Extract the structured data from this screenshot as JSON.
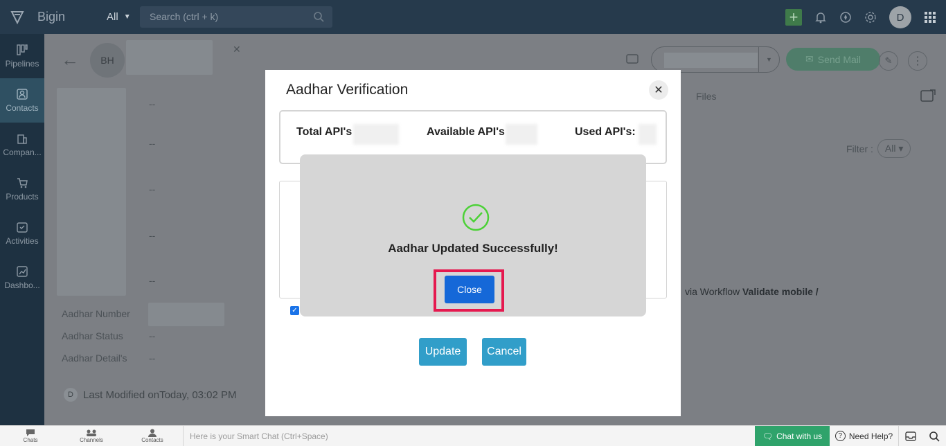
{
  "app": {
    "name": "Bigin"
  },
  "topbar": {
    "scope_label": "All",
    "search_placeholder": "Search (ctrl + k)",
    "user_initial": "D"
  },
  "sidebar": {
    "items": [
      {
        "label": "Pipelines",
        "icon": "pipelines-icon"
      },
      {
        "label": "Contacts",
        "icon": "contacts-icon",
        "active": true
      },
      {
        "label": "Compan...",
        "icon": "companies-icon"
      },
      {
        "label": "Products",
        "icon": "products-icon"
      },
      {
        "label": "Activities",
        "icon": "activities-icon"
      },
      {
        "label": "Dashbo...",
        "icon": "dashboards-icon"
      }
    ]
  },
  "contact": {
    "initials": "BH",
    "fields": [
      {
        "label": "",
        "value": "--"
      },
      {
        "label": "",
        "value": "--"
      },
      {
        "label": "",
        "value": "--"
      },
      {
        "label": "",
        "value": "--"
      },
      {
        "label": "",
        "value": "--"
      },
      {
        "label": "Aadhar Number",
        "value": ""
      },
      {
        "label": "Aadhar Status",
        "value": "--"
      },
      {
        "label": "Aadhar Detail's",
        "value": "--"
      }
    ],
    "last_modified_prefix": "Last Modified on",
    "last_modified_value": "Today, 03:02 PM",
    "last_modified_initial": "D"
  },
  "header_actions": {
    "send_mail": "Send Mail"
  },
  "tabs": {
    "files": "Files"
  },
  "filter": {
    "label": "Filter :",
    "value": "All"
  },
  "timeline": {
    "text_prefix": "via Workflow ",
    "text_bold": "Validate mobile /"
  },
  "modal": {
    "title": "Aadhar Verification",
    "total_api": "Total API's",
    "available_api": "Available API's",
    "used_api": "Used API's:",
    "update": "Update",
    "cancel": "Cancel"
  },
  "success_dialog": {
    "message": "Aadhar Updated Successfully!",
    "close": "Close"
  },
  "bottombar": {
    "chats": "Chats",
    "channels": "Channels",
    "contacts": "Contacts",
    "smartchat_placeholder": "Here is your Smart Chat (Ctrl+Space)",
    "chat_with_us": "Chat with us",
    "need_help": "Need Help?"
  },
  "colors": {
    "accent_green": "#2fa36b",
    "primary_blue": "#1568d8",
    "highlight": "#e5194f",
    "button_teal": "#319ec9"
  }
}
